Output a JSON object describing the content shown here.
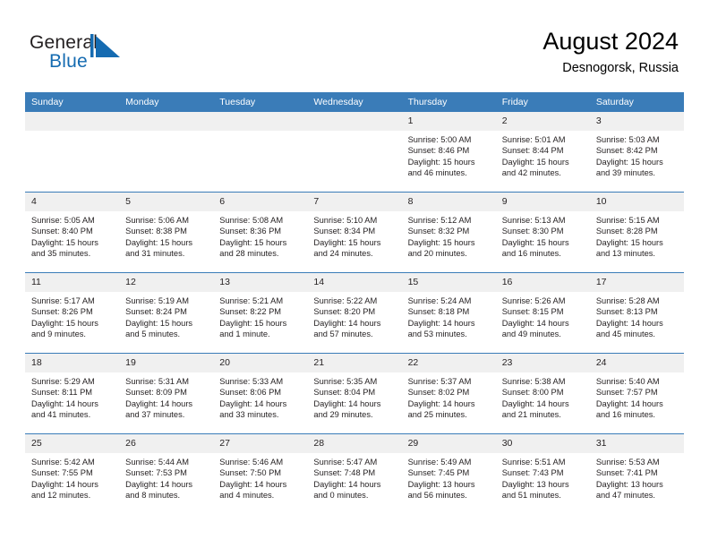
{
  "brand": {
    "name_top": "General",
    "name_bottom": "Blue",
    "mark_icon": "triangle-logo-icon",
    "color_text": "#231f20",
    "color_blue": "#156bb1"
  },
  "header": {
    "title": "August 2024",
    "location": "Desnogorsk, Russia"
  },
  "theme": {
    "header_blue": "#3a7cb8",
    "daynum_band": "#f0f0f0",
    "text": "#231f20"
  },
  "calendar": {
    "weekday_headers": [
      "Sunday",
      "Monday",
      "Tuesday",
      "Wednesday",
      "Thursday",
      "Friday",
      "Saturday"
    ],
    "weeks": [
      [
        {
          "day": "",
          "sunrise": "",
          "sunset": "",
          "daylight_1": "",
          "daylight_2": ""
        },
        {
          "day": "",
          "sunrise": "",
          "sunset": "",
          "daylight_1": "",
          "daylight_2": ""
        },
        {
          "day": "",
          "sunrise": "",
          "sunset": "",
          "daylight_1": "",
          "daylight_2": ""
        },
        {
          "day": "",
          "sunrise": "",
          "sunset": "",
          "daylight_1": "",
          "daylight_2": ""
        },
        {
          "day": "1",
          "sunrise": "Sunrise: 5:00 AM",
          "sunset": "Sunset: 8:46 PM",
          "daylight_1": "Daylight: 15 hours",
          "daylight_2": "and 46 minutes."
        },
        {
          "day": "2",
          "sunrise": "Sunrise: 5:01 AM",
          "sunset": "Sunset: 8:44 PM",
          "daylight_1": "Daylight: 15 hours",
          "daylight_2": "and 42 minutes."
        },
        {
          "day": "3",
          "sunrise": "Sunrise: 5:03 AM",
          "sunset": "Sunset: 8:42 PM",
          "daylight_1": "Daylight: 15 hours",
          "daylight_2": "and 39 minutes."
        }
      ],
      [
        {
          "day": "4",
          "sunrise": "Sunrise: 5:05 AM",
          "sunset": "Sunset: 8:40 PM",
          "daylight_1": "Daylight: 15 hours",
          "daylight_2": "and 35 minutes."
        },
        {
          "day": "5",
          "sunrise": "Sunrise: 5:06 AM",
          "sunset": "Sunset: 8:38 PM",
          "daylight_1": "Daylight: 15 hours",
          "daylight_2": "and 31 minutes."
        },
        {
          "day": "6",
          "sunrise": "Sunrise: 5:08 AM",
          "sunset": "Sunset: 8:36 PM",
          "daylight_1": "Daylight: 15 hours",
          "daylight_2": "and 28 minutes."
        },
        {
          "day": "7",
          "sunrise": "Sunrise: 5:10 AM",
          "sunset": "Sunset: 8:34 PM",
          "daylight_1": "Daylight: 15 hours",
          "daylight_2": "and 24 minutes."
        },
        {
          "day": "8",
          "sunrise": "Sunrise: 5:12 AM",
          "sunset": "Sunset: 8:32 PM",
          "daylight_1": "Daylight: 15 hours",
          "daylight_2": "and 20 minutes."
        },
        {
          "day": "9",
          "sunrise": "Sunrise: 5:13 AM",
          "sunset": "Sunset: 8:30 PM",
          "daylight_1": "Daylight: 15 hours",
          "daylight_2": "and 16 minutes."
        },
        {
          "day": "10",
          "sunrise": "Sunrise: 5:15 AM",
          "sunset": "Sunset: 8:28 PM",
          "daylight_1": "Daylight: 15 hours",
          "daylight_2": "and 13 minutes."
        }
      ],
      [
        {
          "day": "11",
          "sunrise": "Sunrise: 5:17 AM",
          "sunset": "Sunset: 8:26 PM",
          "daylight_1": "Daylight: 15 hours",
          "daylight_2": "and 9 minutes."
        },
        {
          "day": "12",
          "sunrise": "Sunrise: 5:19 AM",
          "sunset": "Sunset: 8:24 PM",
          "daylight_1": "Daylight: 15 hours",
          "daylight_2": "and 5 minutes."
        },
        {
          "day": "13",
          "sunrise": "Sunrise: 5:21 AM",
          "sunset": "Sunset: 8:22 PM",
          "daylight_1": "Daylight: 15 hours",
          "daylight_2": "and 1 minute."
        },
        {
          "day": "14",
          "sunrise": "Sunrise: 5:22 AM",
          "sunset": "Sunset: 8:20 PM",
          "daylight_1": "Daylight: 14 hours",
          "daylight_2": "and 57 minutes."
        },
        {
          "day": "15",
          "sunrise": "Sunrise: 5:24 AM",
          "sunset": "Sunset: 8:18 PM",
          "daylight_1": "Daylight: 14 hours",
          "daylight_2": "and 53 minutes."
        },
        {
          "day": "16",
          "sunrise": "Sunrise: 5:26 AM",
          "sunset": "Sunset: 8:15 PM",
          "daylight_1": "Daylight: 14 hours",
          "daylight_2": "and 49 minutes."
        },
        {
          "day": "17",
          "sunrise": "Sunrise: 5:28 AM",
          "sunset": "Sunset: 8:13 PM",
          "daylight_1": "Daylight: 14 hours",
          "daylight_2": "and 45 minutes."
        }
      ],
      [
        {
          "day": "18",
          "sunrise": "Sunrise: 5:29 AM",
          "sunset": "Sunset: 8:11 PM",
          "daylight_1": "Daylight: 14 hours",
          "daylight_2": "and 41 minutes."
        },
        {
          "day": "19",
          "sunrise": "Sunrise: 5:31 AM",
          "sunset": "Sunset: 8:09 PM",
          "daylight_1": "Daylight: 14 hours",
          "daylight_2": "and 37 minutes."
        },
        {
          "day": "20",
          "sunrise": "Sunrise: 5:33 AM",
          "sunset": "Sunset: 8:06 PM",
          "daylight_1": "Daylight: 14 hours",
          "daylight_2": "and 33 minutes."
        },
        {
          "day": "21",
          "sunrise": "Sunrise: 5:35 AM",
          "sunset": "Sunset: 8:04 PM",
          "daylight_1": "Daylight: 14 hours",
          "daylight_2": "and 29 minutes."
        },
        {
          "day": "22",
          "sunrise": "Sunrise: 5:37 AM",
          "sunset": "Sunset: 8:02 PM",
          "daylight_1": "Daylight: 14 hours",
          "daylight_2": "and 25 minutes."
        },
        {
          "day": "23",
          "sunrise": "Sunrise: 5:38 AM",
          "sunset": "Sunset: 8:00 PM",
          "daylight_1": "Daylight: 14 hours",
          "daylight_2": "and 21 minutes."
        },
        {
          "day": "24",
          "sunrise": "Sunrise: 5:40 AM",
          "sunset": "Sunset: 7:57 PM",
          "daylight_1": "Daylight: 14 hours",
          "daylight_2": "and 16 minutes."
        }
      ],
      [
        {
          "day": "25",
          "sunrise": "Sunrise: 5:42 AM",
          "sunset": "Sunset: 7:55 PM",
          "daylight_1": "Daylight: 14 hours",
          "daylight_2": "and 12 minutes."
        },
        {
          "day": "26",
          "sunrise": "Sunrise: 5:44 AM",
          "sunset": "Sunset: 7:53 PM",
          "daylight_1": "Daylight: 14 hours",
          "daylight_2": "and 8 minutes."
        },
        {
          "day": "27",
          "sunrise": "Sunrise: 5:46 AM",
          "sunset": "Sunset: 7:50 PM",
          "daylight_1": "Daylight: 14 hours",
          "daylight_2": "and 4 minutes."
        },
        {
          "day": "28",
          "sunrise": "Sunrise: 5:47 AM",
          "sunset": "Sunset: 7:48 PM",
          "daylight_1": "Daylight: 14 hours",
          "daylight_2": "and 0 minutes."
        },
        {
          "day": "29",
          "sunrise": "Sunrise: 5:49 AM",
          "sunset": "Sunset: 7:45 PM",
          "daylight_1": "Daylight: 13 hours",
          "daylight_2": "and 56 minutes."
        },
        {
          "day": "30",
          "sunrise": "Sunrise: 5:51 AM",
          "sunset": "Sunset: 7:43 PM",
          "daylight_1": "Daylight: 13 hours",
          "daylight_2": "and 51 minutes."
        },
        {
          "day": "31",
          "sunrise": "Sunrise: 5:53 AM",
          "sunset": "Sunset: 7:41 PM",
          "daylight_1": "Daylight: 13 hours",
          "daylight_2": "and 47 minutes."
        }
      ]
    ]
  }
}
